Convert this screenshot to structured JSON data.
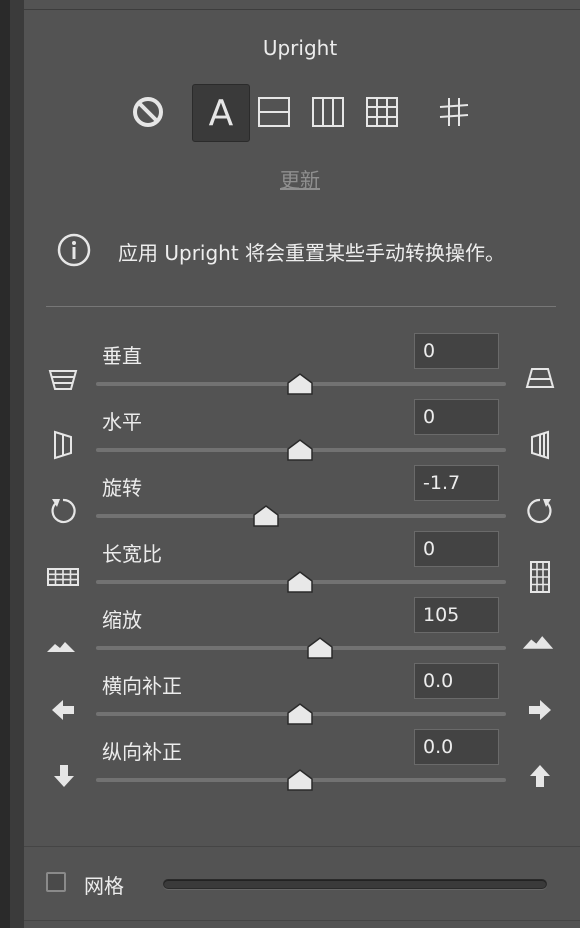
{
  "title": "Upright",
  "upright_modes": [
    {
      "name": "off",
      "icon": "no-icon",
      "active": false
    },
    {
      "name": "auto",
      "icon": "auto-a-icon",
      "label": "A",
      "active": true
    },
    {
      "name": "level",
      "icon": "level-icon",
      "active": false
    },
    {
      "name": "vertical",
      "icon": "vertical-icon",
      "active": false
    },
    {
      "name": "full",
      "icon": "full-grid-icon",
      "active": false
    },
    {
      "name": "guided",
      "icon": "guided-icon",
      "active": false
    }
  ],
  "update_label": "更新",
  "info_text": "应用 Upright 将会重置某些手动转换操作。",
  "sliders": [
    {
      "label": "垂直",
      "value": "0",
      "position": 0.5
    },
    {
      "label": "水平",
      "value": "0",
      "position": 0.5
    },
    {
      "label": "旋转",
      "value": "-1.7",
      "position": 0.415
    },
    {
      "label": "长宽比",
      "value": "0",
      "position": 0.5
    },
    {
      "label": "缩放",
      "value": "105",
      "position": 0.55
    },
    {
      "label": "横向补正",
      "value": "0.0",
      "position": 0.5
    },
    {
      "label": "纵向补正",
      "value": "0.0",
      "position": 0.5
    }
  ],
  "grid": {
    "label": "网格",
    "checked": false
  }
}
